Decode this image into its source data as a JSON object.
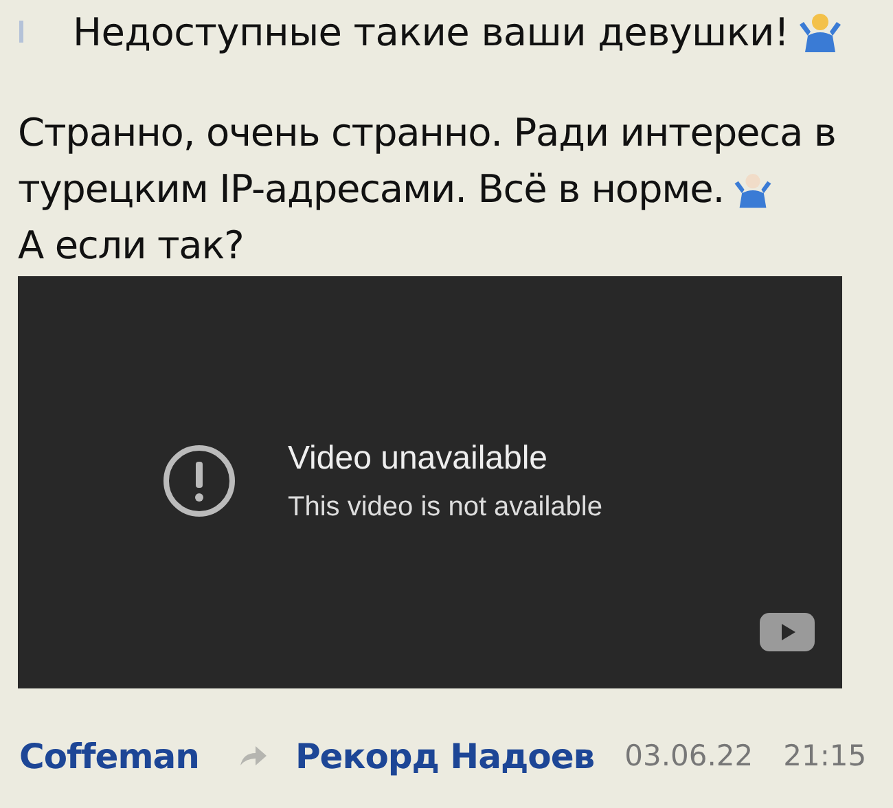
{
  "quote": {
    "text": "Недоступные такие ваши девушки!"
  },
  "message": {
    "lines": [
      "Странно, очень странно. Ради интереса в",
      "турецким IP-адресами. Всё в норме.",
      "А если так?"
    ]
  },
  "video": {
    "title": "Video unavailable",
    "subtitle": "This video is not available"
  },
  "footer": {
    "author": "Coffeman",
    "forwarded_from": "Рекорд Надоев",
    "date": "03.06.22",
    "time": "21:15"
  }
}
